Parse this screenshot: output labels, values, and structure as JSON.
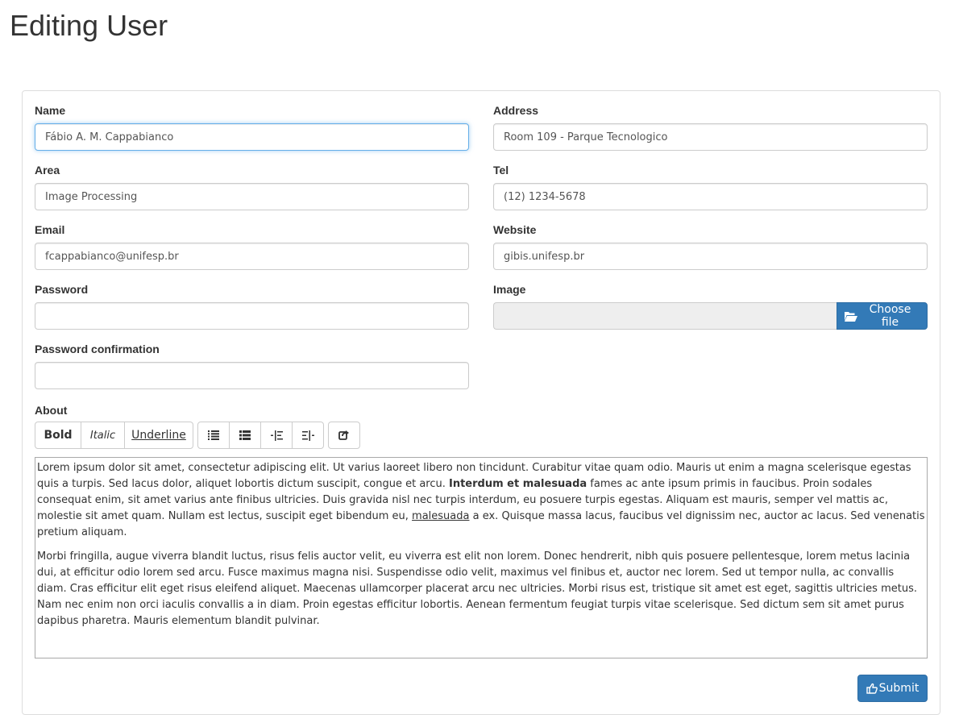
{
  "page": {
    "title": "Editing User"
  },
  "form": {
    "name": {
      "label": "Name",
      "value": "Fábio A. M. Cappabianco"
    },
    "address": {
      "label": "Address",
      "value": "Room 109 - Parque Tecnologico"
    },
    "area": {
      "label": "Area",
      "value": "Image Processing"
    },
    "tel": {
      "label": "Tel",
      "value": "(12) 1234-5678"
    },
    "email": {
      "label": "Email",
      "value": "fcappabianco@unifesp.br"
    },
    "website": {
      "label": "Website",
      "value": "gibis.unifesp.br"
    },
    "password": {
      "label": "Password",
      "value": ""
    },
    "image": {
      "label": "Image",
      "button_label": "Choose file",
      "icon": "folder-open-icon"
    },
    "password_confirmation": {
      "label": "Password confirmation",
      "value": ""
    },
    "about": {
      "label": "About",
      "toolbar": {
        "bold": "Bold",
        "italic": "Italic",
        "underline": "Underline",
        "icons": [
          "unordered-list-icon",
          "ordered-list-icon",
          "outdent-icon",
          "indent-icon",
          "redo-icon"
        ]
      },
      "paragraph1": {
        "part1": "Lorem ipsum dolor sit amet, consectetur adipiscing elit. Ut varius laoreet libero non tincidunt. Curabitur vitae quam odio. Mauris ut enim a magna scelerisque egestas quis a turpis. Sed lacus dolor, aliquet lobortis dictum suscipit, congue et arcu. ",
        "bold": "Interdum et malesuada",
        "part2": " fames ac ante ipsum primis in faucibus. Proin sodales consequat enim, sit amet varius ante finibus ultricies. Duis gravida nisl nec turpis interdum, eu posuere turpis egestas. Aliquam est mauris, semper vel mattis ac, molestie sit amet quam. Nullam est lectus, suscipit eget bibendum eu, ",
        "underline": "malesuada",
        "part3": " a ex. Quisque massa lacus, faucibus vel dignissim nec, auctor ac lacus. Sed venenatis pretium aliquam."
      },
      "paragraph2": "Morbi fringilla, augue viverra blandit luctus, risus felis auctor velit, eu viverra est elit non lorem. Donec hendrerit, nibh quis posuere pellentesque, lorem metus lacinia dui, at efficitur odio lorem sed arcu. Fusce maximus magna nisi. Suspendisse odio velit, maximus vel finibus et, auctor nec lorem. Sed ut tempor nulla, ac convallis diam. Cras efficitur elit eget risus eleifend aliquet. Maecenas ullamcorper placerat arcu nec ultricies. Morbi risus est, tristique sit amet est eget, sagittis ultricies metus. Nam nec enim non orci iaculis convallis a in diam. Proin egestas efficitur lobortis. Aenean fermentum feugiat turpis vitae scelerisque. Sed dictum sem sit amet purus dapibus pharetra. Mauris elementum blandit pulvinar."
    },
    "submit": {
      "label": "Submit",
      "icon": "thumbs-up-icon"
    }
  },
  "colors": {
    "primary": "#337ab7",
    "focus_border": "#66afe9",
    "input_border": "#cccccc",
    "panel_border": "#dddddd"
  }
}
